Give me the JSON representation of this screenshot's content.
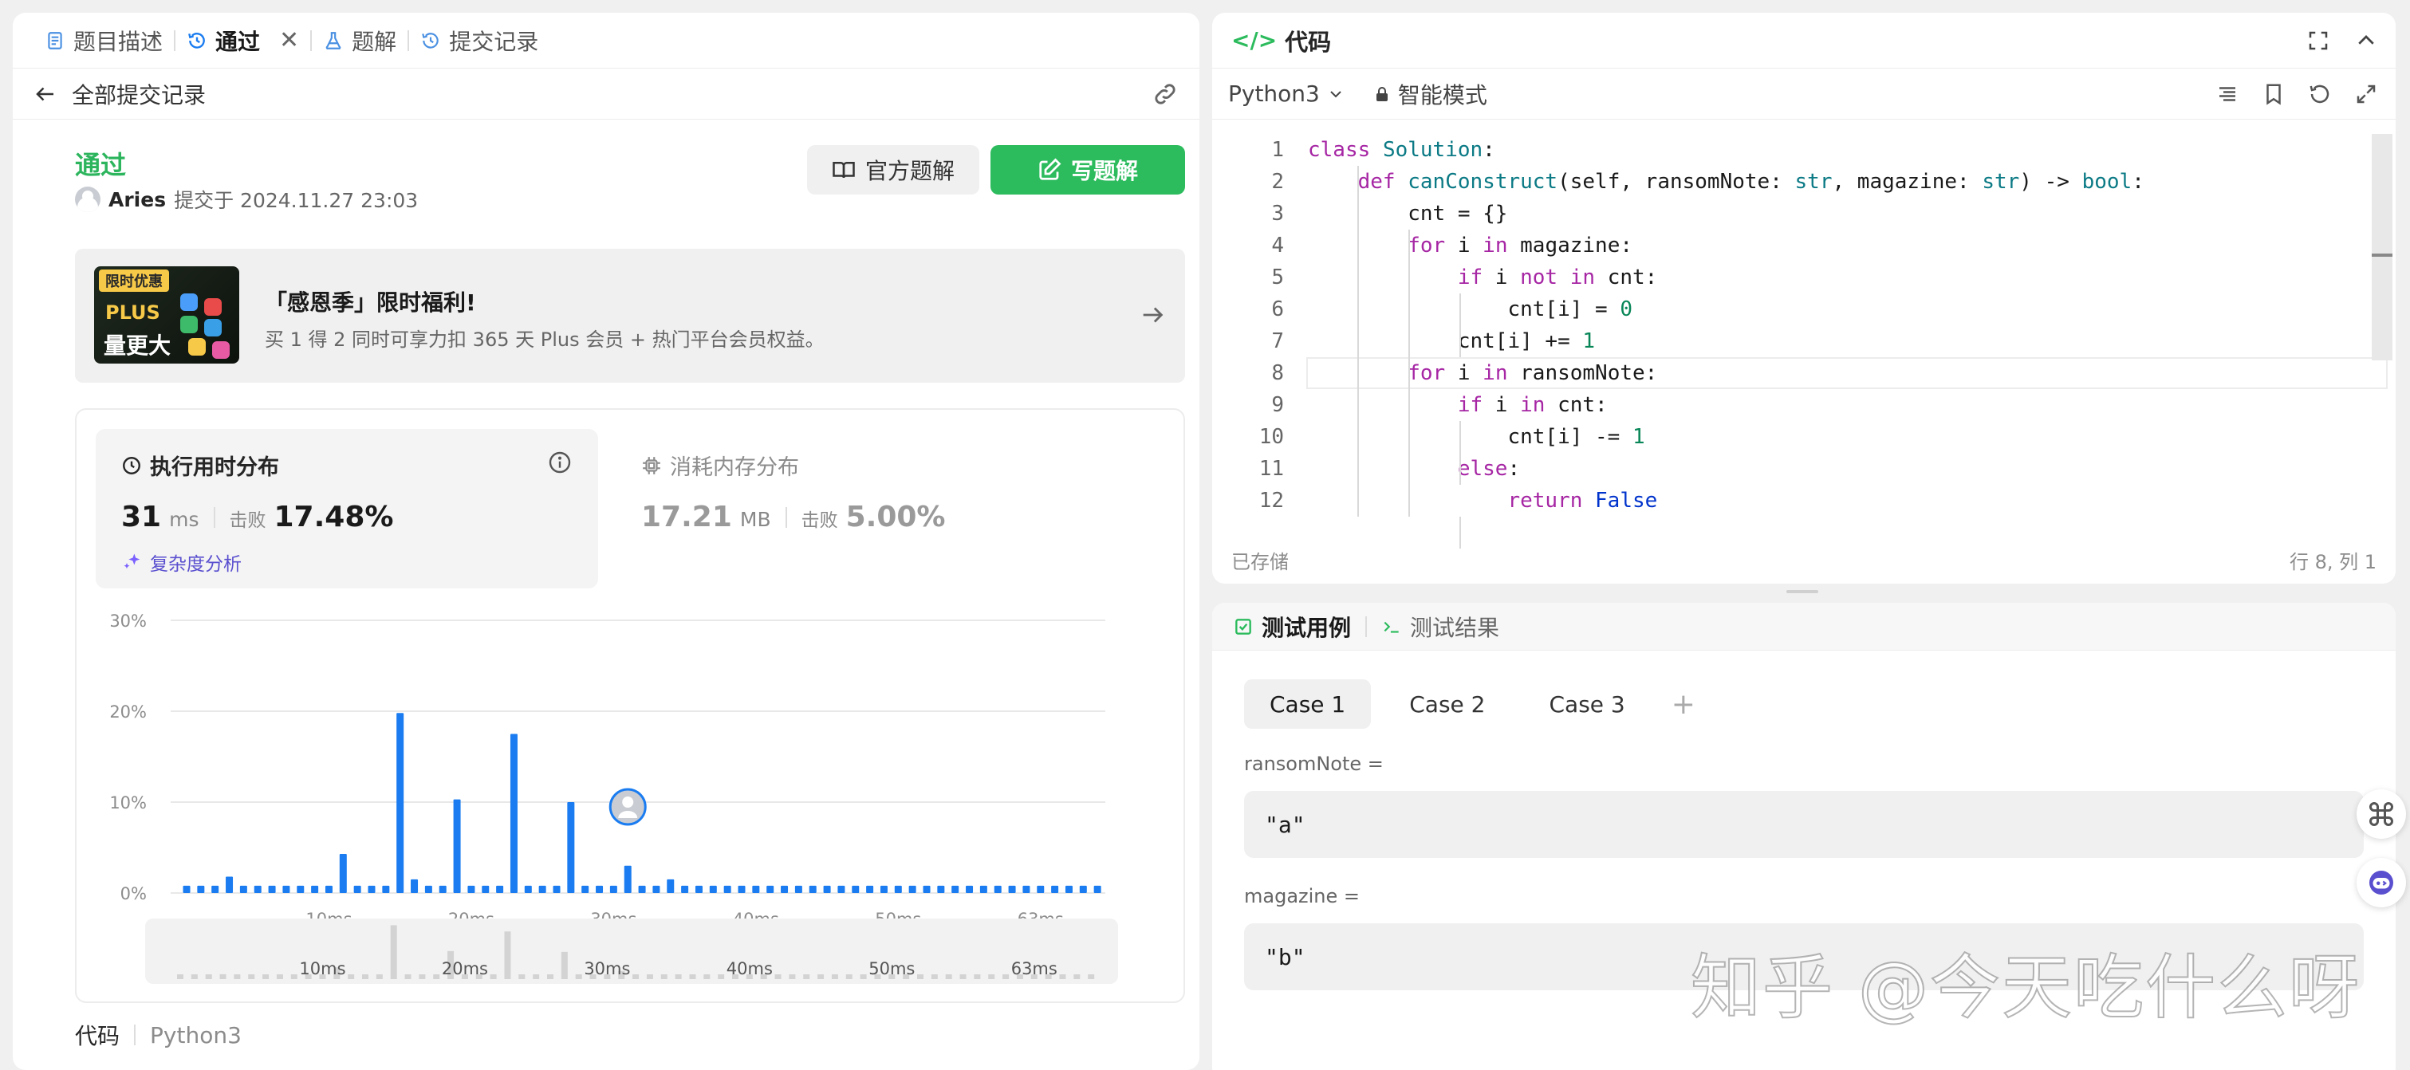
{
  "left_tabs": [
    {
      "label": "题目描述",
      "icon": "document-icon"
    },
    {
      "label": "通过",
      "icon": "history-icon",
      "active": true
    },
    {
      "label": "题解",
      "icon": "flask-icon"
    },
    {
      "label": "提交记录",
      "icon": "history-icon"
    }
  ],
  "subbar": {
    "back_label": "全部提交记录"
  },
  "submission": {
    "status": "通过",
    "author": "Aries",
    "submitted_text": "提交于 2024.11.27 23:03",
    "official_solution_label": "官方题解",
    "write_solution_label": "写题解"
  },
  "promo": {
    "tag": "限时优惠",
    "plus": "PLUS",
    "bigger": "量更大",
    "title": "「感恩季」限时福利!",
    "desc": "买 1 得 2 同时可享力扣 365 天 Plus 会员 + 热门平台会员权益。"
  },
  "runtime": {
    "title": "执行用时分布",
    "value": "31",
    "unit": "ms",
    "beat_label": "击败",
    "beat_value": "17.48%",
    "complexity_label": "复杂度分析"
  },
  "memory": {
    "title": "消耗内存分布",
    "value": "17.21",
    "unit": "MB",
    "beat_label": "击败",
    "beat_value": "5.00%"
  },
  "chart_data": {
    "type": "bar",
    "xlabel": "",
    "ylabel": "",
    "ylim": [
      0,
      30
    ],
    "y_ticks": [
      "0%",
      "10%",
      "20%",
      "30%"
    ],
    "x_ticks": [
      "10ms",
      "20ms",
      "30ms",
      "40ms",
      "50ms",
      "63ms"
    ],
    "x_tick_positions": [
      10,
      20,
      30,
      40,
      50,
      60
    ],
    "x_range": [
      0,
      65
    ],
    "values": [
      {
        "x": 0,
        "y": 0.8
      },
      {
        "x": 1,
        "y": 0.8
      },
      {
        "x": 2,
        "y": 0.8
      },
      {
        "x": 3,
        "y": 1.8
      },
      {
        "x": 4,
        "y": 0.8
      },
      {
        "x": 5,
        "y": 0.8
      },
      {
        "x": 6,
        "y": 0.8
      },
      {
        "x": 7,
        "y": 0.8
      },
      {
        "x": 8,
        "y": 0.8
      },
      {
        "x": 9,
        "y": 0.8
      },
      {
        "x": 10,
        "y": 0.8
      },
      {
        "x": 11,
        "y": 4.3
      },
      {
        "x": 12,
        "y": 0.8
      },
      {
        "x": 13,
        "y": 0.8
      },
      {
        "x": 14,
        "y": 0.8
      },
      {
        "x": 15,
        "y": 19.8
      },
      {
        "x": 16,
        "y": 1.5
      },
      {
        "x": 17,
        "y": 0.8
      },
      {
        "x": 18,
        "y": 0.8
      },
      {
        "x": 19,
        "y": 10.3
      },
      {
        "x": 20,
        "y": 0.8
      },
      {
        "x": 21,
        "y": 0.8
      },
      {
        "x": 22,
        "y": 0.8
      },
      {
        "x": 23,
        "y": 17.5
      },
      {
        "x": 24,
        "y": 0.8
      },
      {
        "x": 25,
        "y": 0.8
      },
      {
        "x": 26,
        "y": 0.8
      },
      {
        "x": 27,
        "y": 10.0
      },
      {
        "x": 28,
        "y": 0.8
      },
      {
        "x": 29,
        "y": 0.8
      },
      {
        "x": 30,
        "y": 0.8
      },
      {
        "x": 31,
        "y": 3.0
      },
      {
        "x": 32,
        "y": 0.8
      },
      {
        "x": 33,
        "y": 0.8
      },
      {
        "x": 34,
        "y": 1.5
      },
      {
        "x": 35,
        "y": 0.8
      },
      {
        "x": 36,
        "y": 0.8
      },
      {
        "x": 37,
        "y": 0.8
      },
      {
        "x": 38,
        "y": 0.8
      },
      {
        "x": 39,
        "y": 0.8
      },
      {
        "x": 40,
        "y": 0.8
      },
      {
        "x": 41,
        "y": 0.8
      },
      {
        "x": 42,
        "y": 0.8
      },
      {
        "x": 43,
        "y": 0.8
      },
      {
        "x": 44,
        "y": 0.8
      },
      {
        "x": 45,
        "y": 0.8
      },
      {
        "x": 46,
        "y": 0.8
      },
      {
        "x": 47,
        "y": 0.8
      },
      {
        "x": 48,
        "y": 0.8
      },
      {
        "x": 49,
        "y": 0.8
      },
      {
        "x": 50,
        "y": 0.8
      },
      {
        "x": 51,
        "y": 0.8
      },
      {
        "x": 52,
        "y": 0.8
      },
      {
        "x": 53,
        "y": 0.8
      },
      {
        "x": 54,
        "y": 0.8
      },
      {
        "x": 55,
        "y": 0.8
      },
      {
        "x": 56,
        "y": 0.8
      },
      {
        "x": 57,
        "y": 0.8
      },
      {
        "x": 58,
        "y": 0.8
      },
      {
        "x": 59,
        "y": 0.8
      },
      {
        "x": 60,
        "y": 0.8
      },
      {
        "x": 61,
        "y": 0.8
      },
      {
        "x": 62,
        "y": 0.8
      },
      {
        "x": 63,
        "y": 0.8
      },
      {
        "x": 64,
        "y": 0.8
      }
    ],
    "user_marker_x": 31,
    "grid": true,
    "colors": {
      "bar": "#1a7cf0",
      "grid": "#e8e8e8"
    }
  },
  "code_footer": {
    "label": "代码",
    "lang": "Python3"
  },
  "editor": {
    "title": "代码",
    "language": "Python3",
    "mode": "智能模式",
    "status": "已存储",
    "cursor": "行 8, 列 1",
    "lines": [
      {
        "n": "1",
        "text": "class Solution:"
      },
      {
        "n": "2",
        "text": "    def canConstruct(self, ransomNote: str, magazine: str) -> bool:"
      },
      {
        "n": "3",
        "text": "        cnt = {}"
      },
      {
        "n": "4",
        "text": "        for i in magazine:"
      },
      {
        "n": "5",
        "text": "            if i not in cnt:"
      },
      {
        "n": "6",
        "text": "                cnt[i] = 0"
      },
      {
        "n": "7",
        "text": "            cnt[i] += 1"
      },
      {
        "n": "8",
        "text": "        for i in ransomNote:"
      },
      {
        "n": "9",
        "text": "            if i in cnt:"
      },
      {
        "n": "10",
        "text": "                cnt[i] -= 1"
      },
      {
        "n": "11",
        "text": "            else:"
      },
      {
        "n": "12",
        "text": "                return False"
      }
    ]
  },
  "tests": {
    "tab_cases": "测试用例",
    "tab_results": "测试结果",
    "cases": [
      "Case 1",
      "Case 2",
      "Case 3"
    ],
    "fields": [
      {
        "label": "ransomNote =",
        "value": "\"a\""
      },
      {
        "label": "magazine =",
        "value": "\"b\""
      }
    ]
  },
  "watermark": "知乎 @今天吃什么呀",
  "colors": {
    "accent_green": "#2cbb5d",
    "accent_blue": "#1a7cf0",
    "purple": "#5a4fcf"
  }
}
